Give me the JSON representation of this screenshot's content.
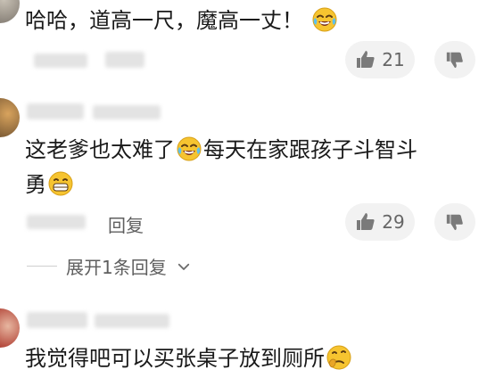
{
  "comments": [
    {
      "text_before": "哈哈，道高一尺，魔高一丈！",
      "emoji_after": "laughing-tears-emoji",
      "likes": "21"
    },
    {
      "text_line1_before": "这老爹也太难了",
      "emoji_mid": "laughing-tears-emoji",
      "text_line1_after": "每天在家跟孩子斗智斗",
      "text_line2": "勇",
      "emoji_after": "grinning-emoji",
      "reply_label": "回复",
      "likes": "29",
      "expand_replies_label": "展开1条回复"
    },
    {
      "text_before": "我觉得吧可以买张桌子放到厕所",
      "emoji_after": "thinking-emoji"
    }
  ],
  "colors": {
    "text": "#1a1a1a",
    "meta": "#5f5f5f",
    "pill_bg": "#f2f2f2"
  },
  "icons": {
    "like": "thumb-up-icon",
    "dislike": "thumb-down-icon",
    "chevron": "chevron-down-icon"
  }
}
